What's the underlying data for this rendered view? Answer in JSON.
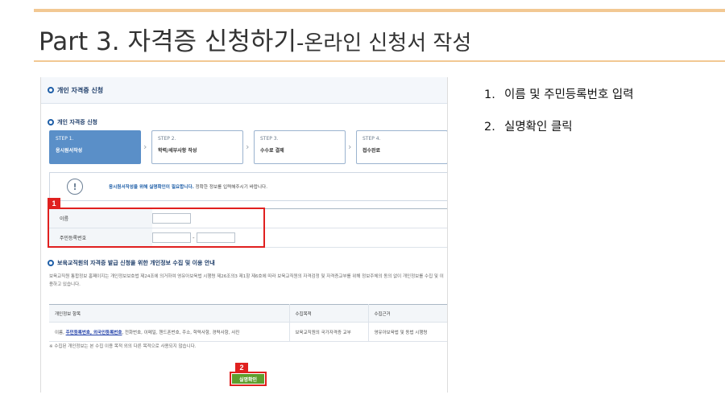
{
  "slide": {
    "title_main": "Part 3. 자격증 신청하기",
    "title_sub": "-온라인 신청서 작성"
  },
  "screenshot": {
    "header_title": "개인 자격증 신청",
    "section_title": "개인 자격증 신청",
    "steps": [
      {
        "num": "STEP 1.",
        "name": "응시원서작성"
      },
      {
        "num": "STEP 2.",
        "name": "학력/세부사항 작성"
      },
      {
        "num": "STEP 3.",
        "name": "수수료 결제"
      },
      {
        "num": "STEP 4.",
        "name": "접수완료"
      }
    ],
    "notice": {
      "highlight": "응시원서작성을 위해 실명확인이 필요합니다.",
      "rest": " 정확한 정보를 입력해주시기 바랍니다."
    },
    "form": {
      "name_label": "이름",
      "rrn_label": "주민등록번호",
      "rrn_sep": "-"
    },
    "privacy": {
      "title": "보육교직원의 자격증 발급 신청을 위한 개인정보 수집 및 이용 안내",
      "paragraph": "보육교직원 통합정보 홈페이지는 개인정보보호법 제24조에 의거하여 영유아보육법 시행령 제26조의3 제1항 제6호에 따라 보육교직원의 자격검정 및 자격증교부를 위해 정보주체의 동의 없이 개인정보를 수집 및 이용하고 있습니다.",
      "table_headers": [
        "개인정보 항목",
        "수집목적",
        "수집근거"
      ],
      "row": {
        "prefix": "이름, ",
        "underlined": "주민등록번호, 외국인등록번호",
        "suffix": ", 전화번호, 이메일, 핸드폰번호, 주소, 학력사항, 경력사항, 사진",
        "purpose": "보육교직원의 국가자격증 교부",
        "basis": "영유아보육법 및 동법 시행령"
      },
      "note": "※ 수집된 개인정보는 본 수집 이용 목적 외의 다른 목적으로 사용되지 않습니다."
    },
    "confirm_button": "실명확인",
    "badges": [
      "1",
      "2"
    ]
  },
  "instructions": [
    {
      "num": "1.",
      "text": "이름 및 주민등록번호 입력"
    },
    {
      "num": "2.",
      "text": "실명확인 클릭"
    }
  ],
  "colors": {
    "accent_rule": "#f2c893",
    "highlight_red": "#e0201f",
    "step_active": "#5a8fc8",
    "confirm_green": "#5e9e2d"
  },
  "icons": [
    "info-circle-icon",
    "bullet-circle-icon",
    "chevron-right-icon"
  ]
}
